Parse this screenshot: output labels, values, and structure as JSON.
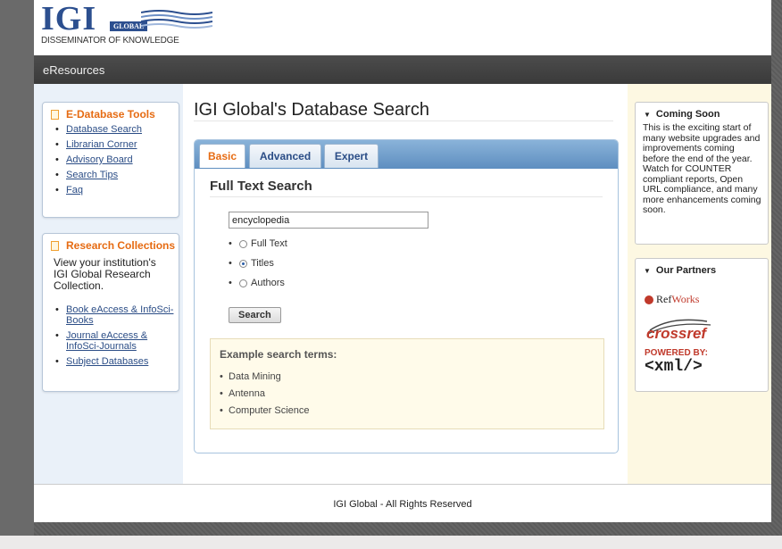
{
  "logo": {
    "wordmark": "IGI",
    "global": "GLOBAL",
    "tagline": "DISSEMINATOR OF KNOWLEDGE"
  },
  "topnav": {
    "label": "eResources"
  },
  "left": {
    "tools": {
      "title": "E-Database Tools",
      "items": [
        "Database Search",
        "Librarian Corner",
        "Advisory Board",
        "Search Tips",
        "Faq"
      ]
    },
    "collections": {
      "title": "Research Collections",
      "intro": "View your institution's IGI Global Research Collection.",
      "items": [
        "Book eAccess & InfoSci-Books",
        "Journal eAccess & InfoSci-Journals",
        "Subject Databases"
      ]
    }
  },
  "main": {
    "title": "IGI Global's Database Search",
    "tabs": [
      "Basic",
      "Advanced",
      "Expert"
    ],
    "active_tab": "Basic",
    "section_title": "Full Text Search",
    "query": "encyclopedia",
    "options": [
      "Full Text",
      "Titles",
      "Authors"
    ],
    "selected_option": "Titles",
    "search_button": "Search",
    "examples_title": "Example search terms:",
    "examples": [
      "Data Mining",
      "Antenna",
      "Computer Science"
    ]
  },
  "right": {
    "coming_soon": {
      "title": "Coming Soon",
      "text": "This is the exciting start of many website upgrades and improvements coming before the end of the year. Watch for COUNTER compliant reports, Open URL compliance, and many more enhancements coming soon."
    },
    "partners": {
      "title": "Our Partners",
      "refworks_ref": "Ref",
      "refworks_works": "Works",
      "crossref": "crossref",
      "powered_by": "POWERED BY:",
      "xml": "<xml/>"
    }
  },
  "footer": {
    "text": "IGI Global - All Rights Reserved"
  },
  "colors": {
    "accent_orange": "#e66b12",
    "link_blue": "#2b4d86",
    "tab_blue": "#5e8ec0",
    "nav_dark": "#3a3a3a"
  }
}
